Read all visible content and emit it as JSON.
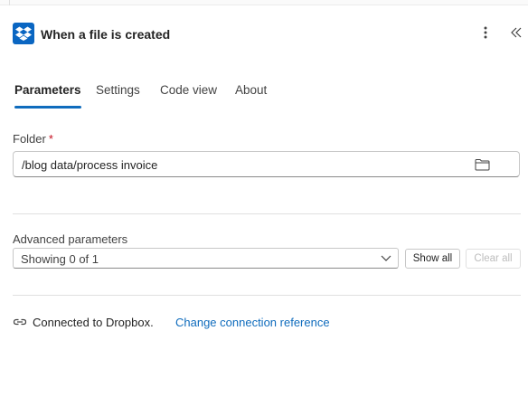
{
  "header": {
    "title": "When a file is created",
    "icons": {
      "logo": "dropbox-logo",
      "more": "more-vertical-icon",
      "collapse": "double-chevron-left-icon"
    }
  },
  "tabs": [
    {
      "label": "Parameters",
      "active": true
    },
    {
      "label": "Settings",
      "active": false
    },
    {
      "label": "Code view",
      "active": false
    },
    {
      "label": "About",
      "active": false
    }
  ],
  "folder": {
    "label": "Folder",
    "required_mark": "*",
    "value": "/blog data/process invoice",
    "icon": "folder-icon"
  },
  "advanced": {
    "label": "Advanced parameters",
    "selected": "Showing 0 of 1",
    "show_all_label": "Show all",
    "clear_all_label": "Clear all",
    "clear_all_enabled": false
  },
  "connection": {
    "text": "Connected to Dropbox.",
    "change_link": "Change connection reference",
    "icon": "link-icon"
  },
  "colors": {
    "accent": "#0f6cbd",
    "dropbox_blue": "#0a66c2",
    "required": "#c50f1f"
  }
}
